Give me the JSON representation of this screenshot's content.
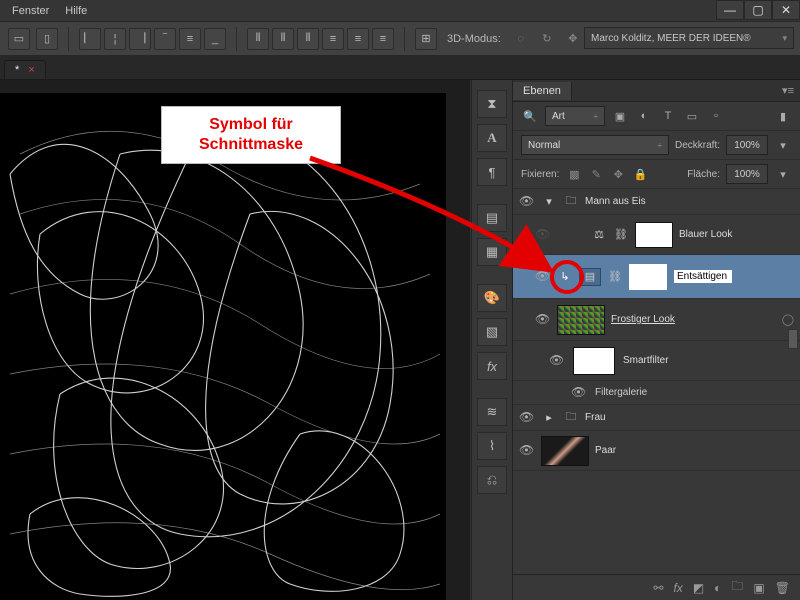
{
  "menu": {
    "fenster": "Fenster",
    "hilfe": "Hilfe"
  },
  "mode3d_label": "3D-Modus:",
  "user_badge": "Marco Kolditz, MEER DER IDEEN®",
  "doc_tab_marker": "*",
  "panel": {
    "title": "Ebenen",
    "filter_kind": "Art",
    "blend_mode": "Normal",
    "opacity_label": "Deckkraft:",
    "opacity_value": "100%",
    "lock_label": "Fixieren:",
    "fill_label": "Fläche:",
    "fill_value": "100%"
  },
  "layers": {
    "group_main": "Mann aus Eis",
    "look_blue": "Blauer Look",
    "desat_input": "Entsättigen",
    "look_frost": "Frostiger Look",
    "smartfilter": "Smartfilter",
    "filtergalerie": "Filtergalerie",
    "group_frau": "Frau",
    "paar": "Paar"
  },
  "callout": {
    "line1": "Symbol für",
    "line2": "Schnittmaske"
  }
}
